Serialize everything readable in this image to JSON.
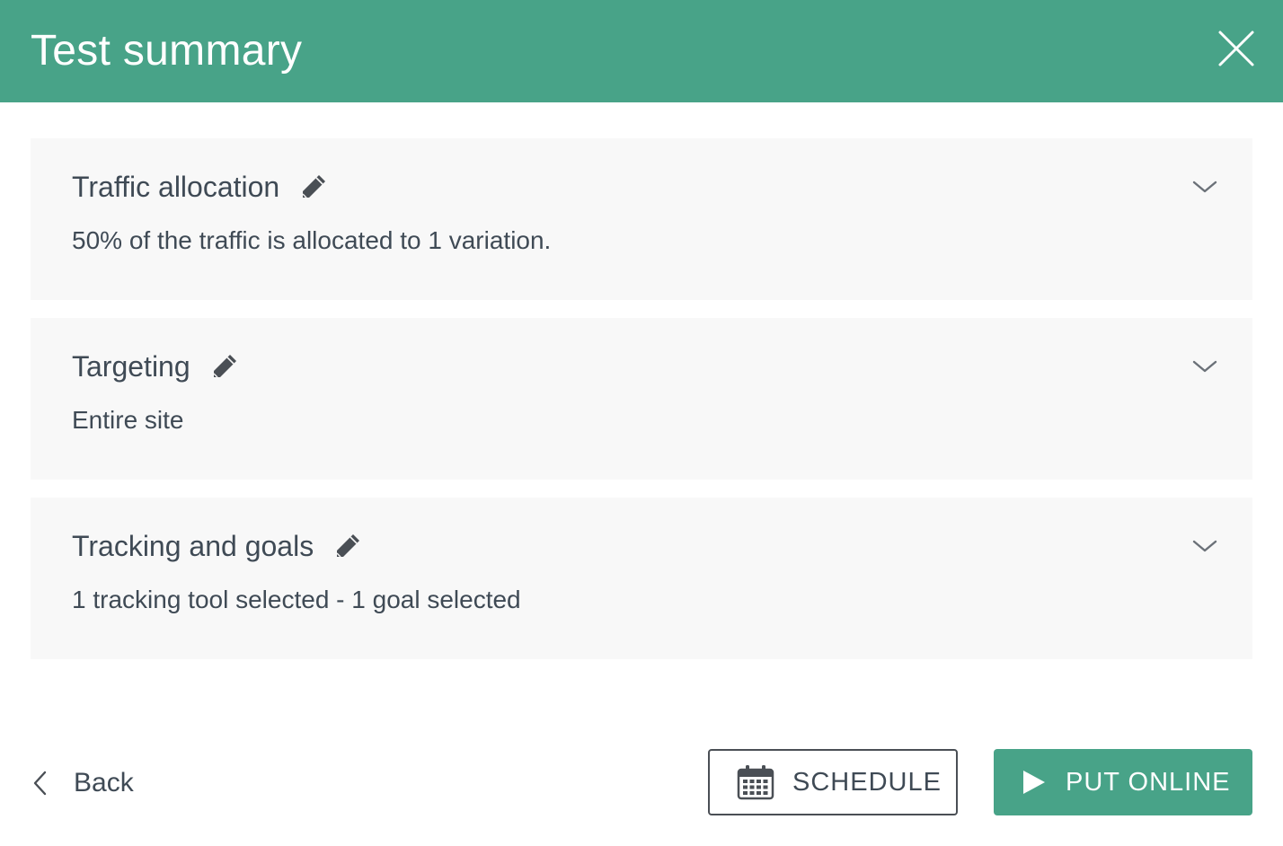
{
  "header": {
    "title": "Test summary"
  },
  "sections": [
    {
      "title": "Traffic allocation",
      "description": "50% of the traffic is allocated to 1 variation."
    },
    {
      "title": "Targeting",
      "description": "Entire site"
    },
    {
      "title": "Tracking and goals",
      "description": "1 tracking tool selected - 1 goal selected"
    }
  ],
  "footer": {
    "back_label": "Back",
    "schedule_label": "SCHEDULE",
    "put_online_label": "PUT ONLINE"
  },
  "icons": {
    "close": "close-icon",
    "edit": "pencil-icon",
    "expand": "chevron-down-icon",
    "back": "chevron-left-icon",
    "schedule": "calendar-icon",
    "put_online": "play-icon"
  },
  "colors": {
    "brand": "#48a388",
    "text": "#3f4a55",
    "section_bg": "#f8f8f8"
  }
}
